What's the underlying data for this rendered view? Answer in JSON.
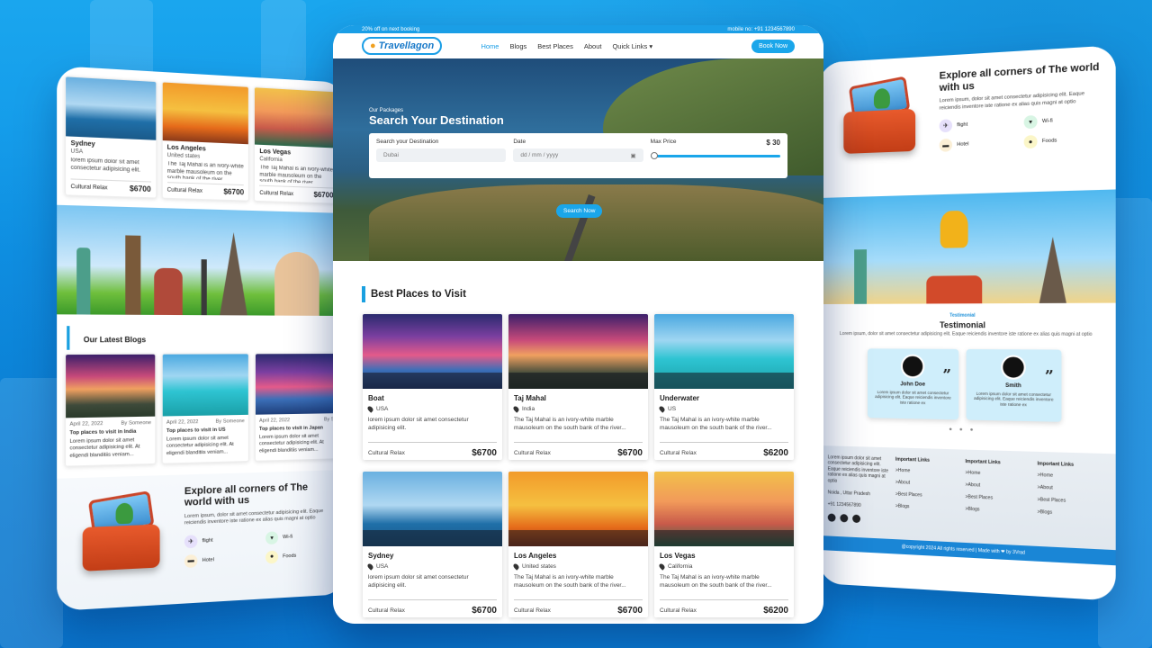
{
  "center": {
    "offer_text": "20% off on next booking",
    "mobile_text": "mobile no: +91 1234567890",
    "logo_text": "Travellagon",
    "nav": [
      "Home",
      "Blogs",
      "Best Places",
      "About",
      "Quick Links"
    ],
    "book_button": "Book Now",
    "hero_small": "Our Packages",
    "hero_title": "Search Your Destination",
    "search_dest_label": "Search your Destination",
    "search_dest_value": "Dubai",
    "date_label": "Date",
    "date_placeholder": "dd / mm / yyyy",
    "max_price_label": "Max Price",
    "max_price_value": "$ 30",
    "max_price_fraction": 0.0,
    "search_button": "Search Now",
    "section_title": "Best Places to Visit",
    "cards": [
      {
        "title": "Boat",
        "location": "USA",
        "desc": "lorem ipsum dolor sit amet consectetur adipisicing elit.",
        "category": "Cultural Relax",
        "price": "$6700",
        "img": "img-boat"
      },
      {
        "title": "Taj Mahal",
        "location": "India",
        "desc": "The Taj Mahal is an ivory-white marble mausoleum on the south bank of the river...",
        "category": "Cultural Relax",
        "price": "$6700",
        "img": "img-taj"
      },
      {
        "title": "Underwater",
        "location": "US",
        "desc": "The Taj Mahal is an ivory-white marble mausoleum on the south bank of the river...",
        "category": "Cultural Relax",
        "price": "$6200",
        "img": "img-water"
      },
      {
        "title": "Sydney",
        "location": "USA",
        "desc": "lorem ipsum dolor sit amet consectetur adipisicing elit.",
        "category": "Cultural Relax",
        "price": "$6700",
        "img": "img-sydney"
      },
      {
        "title": "Los Angeles",
        "location": "United states",
        "desc": "The Taj Mahal is an ivory-white marble mausoleum on the south bank of the river...",
        "category": "Cultural Relax",
        "price": "$6700",
        "img": "img-la"
      },
      {
        "title": "Los Vegas",
        "location": "California",
        "desc": "The Taj Mahal is an ivory-white marble mausoleum on the south bank of the river...",
        "category": "Cultural Relax",
        "price": "$6200",
        "img": "img-vegas"
      }
    ]
  },
  "left": {
    "mini_cards": [
      {
        "title": "Sydney",
        "location": "USA",
        "desc": "lorem ipsum dolor sit amet consectetur adipisicing elit.",
        "category": "Cultural Relax",
        "price": "$6700",
        "img": "img-sydney"
      },
      {
        "title": "Los Angeles",
        "location": "United states",
        "desc": "The Taj Mahal is an ivory-white marble mausoleum on the south bank of the river...",
        "category": "Cultural Relax",
        "price": "$6700",
        "img": "img-la"
      },
      {
        "title": "Los Vegas",
        "location": "California",
        "desc": "The Taj Mahal is an ivory-white marble mausoleum on the south bank of the river...",
        "category": "Cultural Relax",
        "price": "$6700",
        "img": "img-vegas"
      }
    ],
    "blogs_title": "Our Latest Blogs",
    "blogs": [
      {
        "date": "April 22, 2022",
        "by": "By Someone",
        "title": "Top places to visit in India",
        "desc": "Lorem ipsum dolor sit amet consectetur adipisicing elit. At eligendi blanditiis veniam...",
        "img": "img-taj"
      },
      {
        "date": "April 22, 2022",
        "by": "By Someone",
        "title": "Top places to visit in US",
        "desc": "Lorem ipsum dolor sit amet consectetur adipisicing elit. At eligendi blanditiis veniam...",
        "img": "img-water"
      },
      {
        "date": "April 22, 2022",
        "by": "By S",
        "title": "Top places to visit in Japan",
        "desc": "Lorem ipsum dolor sit amet consectetur adipisicing elit. At eligendi blanditiis veniam...",
        "img": "img-boat"
      }
    ],
    "explore_title": "Explore all corners of The world with us",
    "explore_desc": "Lorem ipsum, dolor sit amet consectetur adipisicing elit. Eaque reiciendis inventore iste ratione ex alias quis magni at optio",
    "features": [
      "flight",
      "Wi-fi",
      "Hotel",
      "Foods"
    ]
  },
  "right": {
    "explore_title": "Explore all corners of The world with us",
    "explore_desc": "Lorem ipsum, dolor sit amet consectetur adipisicing elit. Eaque reiciendis inventore iste ratione ex alias quis magni at optio",
    "features": [
      "flight",
      "Wi-fi",
      "Hotel",
      "Foods"
    ],
    "testimonial_small": "Testimonial",
    "testimonial_title": "Testimonial",
    "testimonial_desc": "Lorem ipsum, dolor sit amet consectetur adipisicing elit. Eaque reiciendis inventore iste ratione ex alias quis magni at optio",
    "testimonials": [
      {
        "name": "John Doe",
        "text": "Lorem ipsum dolor sit amet consectetur adipisicing elit. Eaque reiciendis inventore iste ratione ex"
      },
      {
        "name": "Smith",
        "text": "Lorem ipsum dolor sit amet consectetur adipisicing elit. Eaque reiciendis inventore iste ratione ex"
      }
    ],
    "footer_about": "Lorem ipsum dolor sit amet consectetur adipisicing elit. Eaque reiciendis inventore iste ratione ex alias quis magni at optio",
    "footer_city": "Noida , Uttar Pradesh",
    "footer_phone": "+91 1234567890",
    "footer_cols": [
      {
        "title": "Important Links",
        "links": [
          "Home",
          "About",
          "Best Places",
          "Blogs"
        ]
      },
      {
        "title": "Important Links",
        "links": [
          "Home",
          "About",
          "Best Places",
          "Blogs"
        ]
      },
      {
        "title": "Important Links",
        "links": [
          "Home",
          "About",
          "Best Places",
          "Blogs"
        ]
      }
    ],
    "copyright": "@copyright 2024 All rights reserved | Made with ❤ by 3Vrad"
  }
}
